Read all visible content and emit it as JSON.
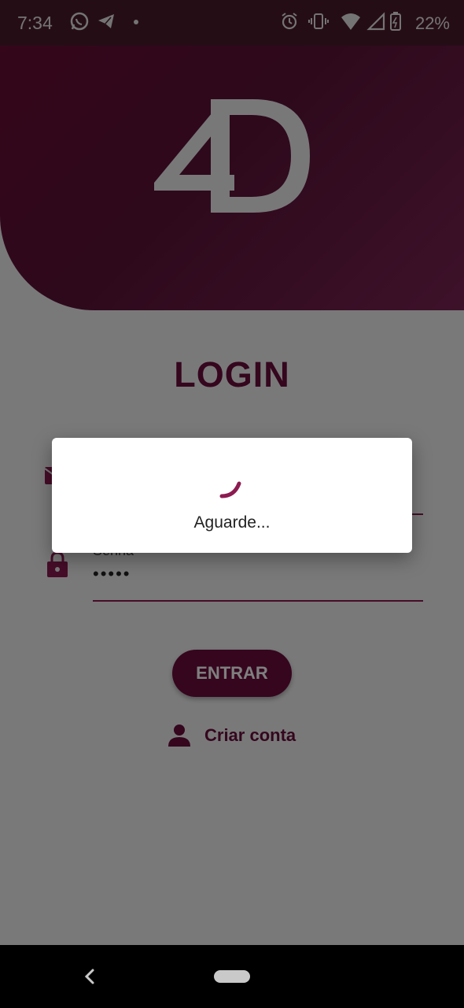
{
  "status_bar": {
    "time": "7:34",
    "battery": "22%",
    "icons": [
      "whatsapp-icon",
      "telegram-icon",
      "dot-icon",
      "alarm-icon",
      "vibrate-icon",
      "wifi-icon",
      "signal-icon",
      "battery-icon"
    ]
  },
  "brand": {
    "logo_text": "4D",
    "primary_color": "#6b0d3c",
    "accent_color": "#8c1b51"
  },
  "login": {
    "title": "LOGIN",
    "password_label": "Senha",
    "password_value": "•••••",
    "submit_label": "ENTRAR",
    "create_account_label": "Criar conta"
  },
  "dialog": {
    "message": "Aguarde..."
  },
  "nav": {
    "icons": [
      "back-icon",
      "home-pill"
    ]
  }
}
